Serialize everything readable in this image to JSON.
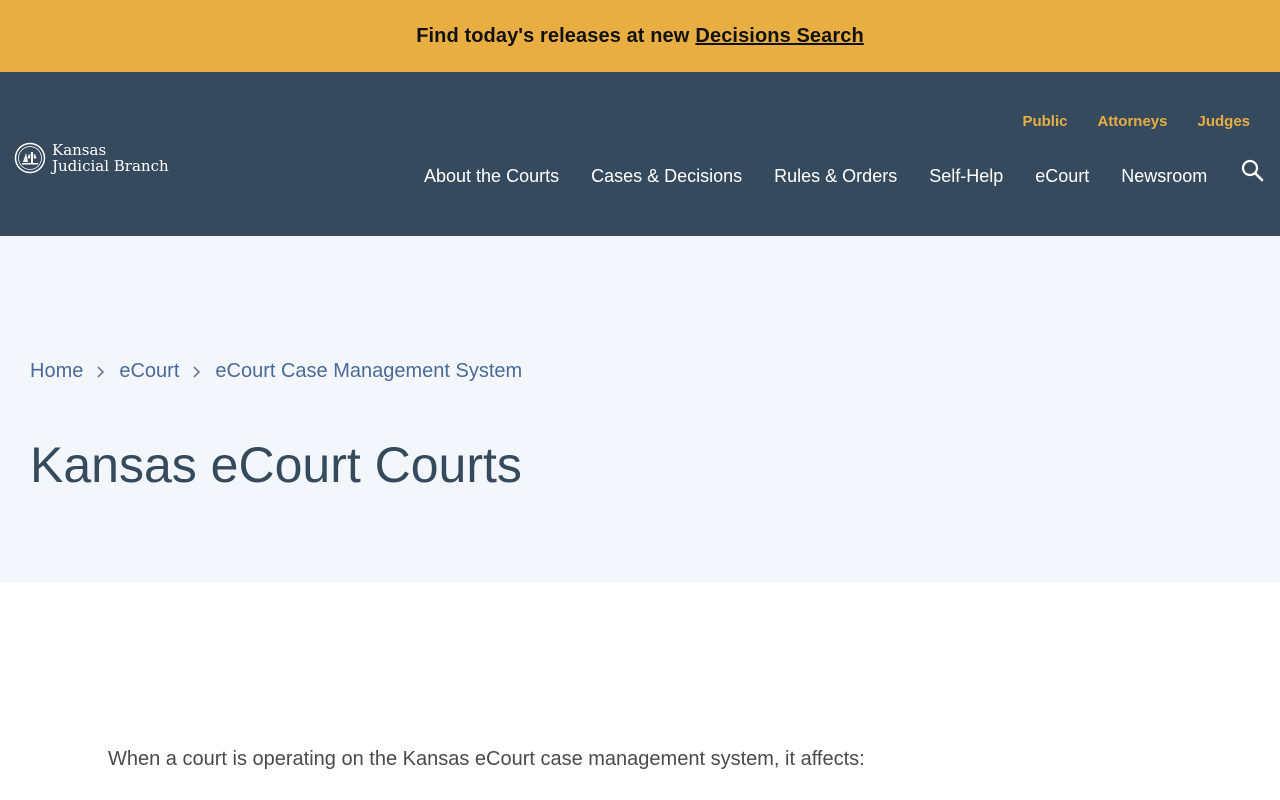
{
  "banner": {
    "text": "Find today's releases at new",
    "link": "Decisions Search"
  },
  "brand": {
    "line1": "Kansas",
    "line2": "Judicial Branch",
    "logo_icon": "kansas-seal-icon"
  },
  "audience_nav": [
    "Public",
    "Attorneys",
    "Judges"
  ],
  "main_nav": [
    "About the Courts",
    "Cases & Decisions",
    "Rules & Orders",
    "Self-Help",
    "eCourt",
    "Newsroom"
  ],
  "search": {
    "icon": "search-icon"
  },
  "breadcrumb": [
    "Home",
    "eCourt",
    "eCourt Case Management System"
  ],
  "page_title": "Kansas eCourt Courts",
  "intro_text": "When a court is operating on the Kansas eCourt case management system, it affects:",
  "colors": {
    "banner_bg": "#e8ae42",
    "header_bg": "#364a5e",
    "hero_bg": "#f3f7fc",
    "accent": "#e8ae42",
    "link": "#4a6a99"
  }
}
